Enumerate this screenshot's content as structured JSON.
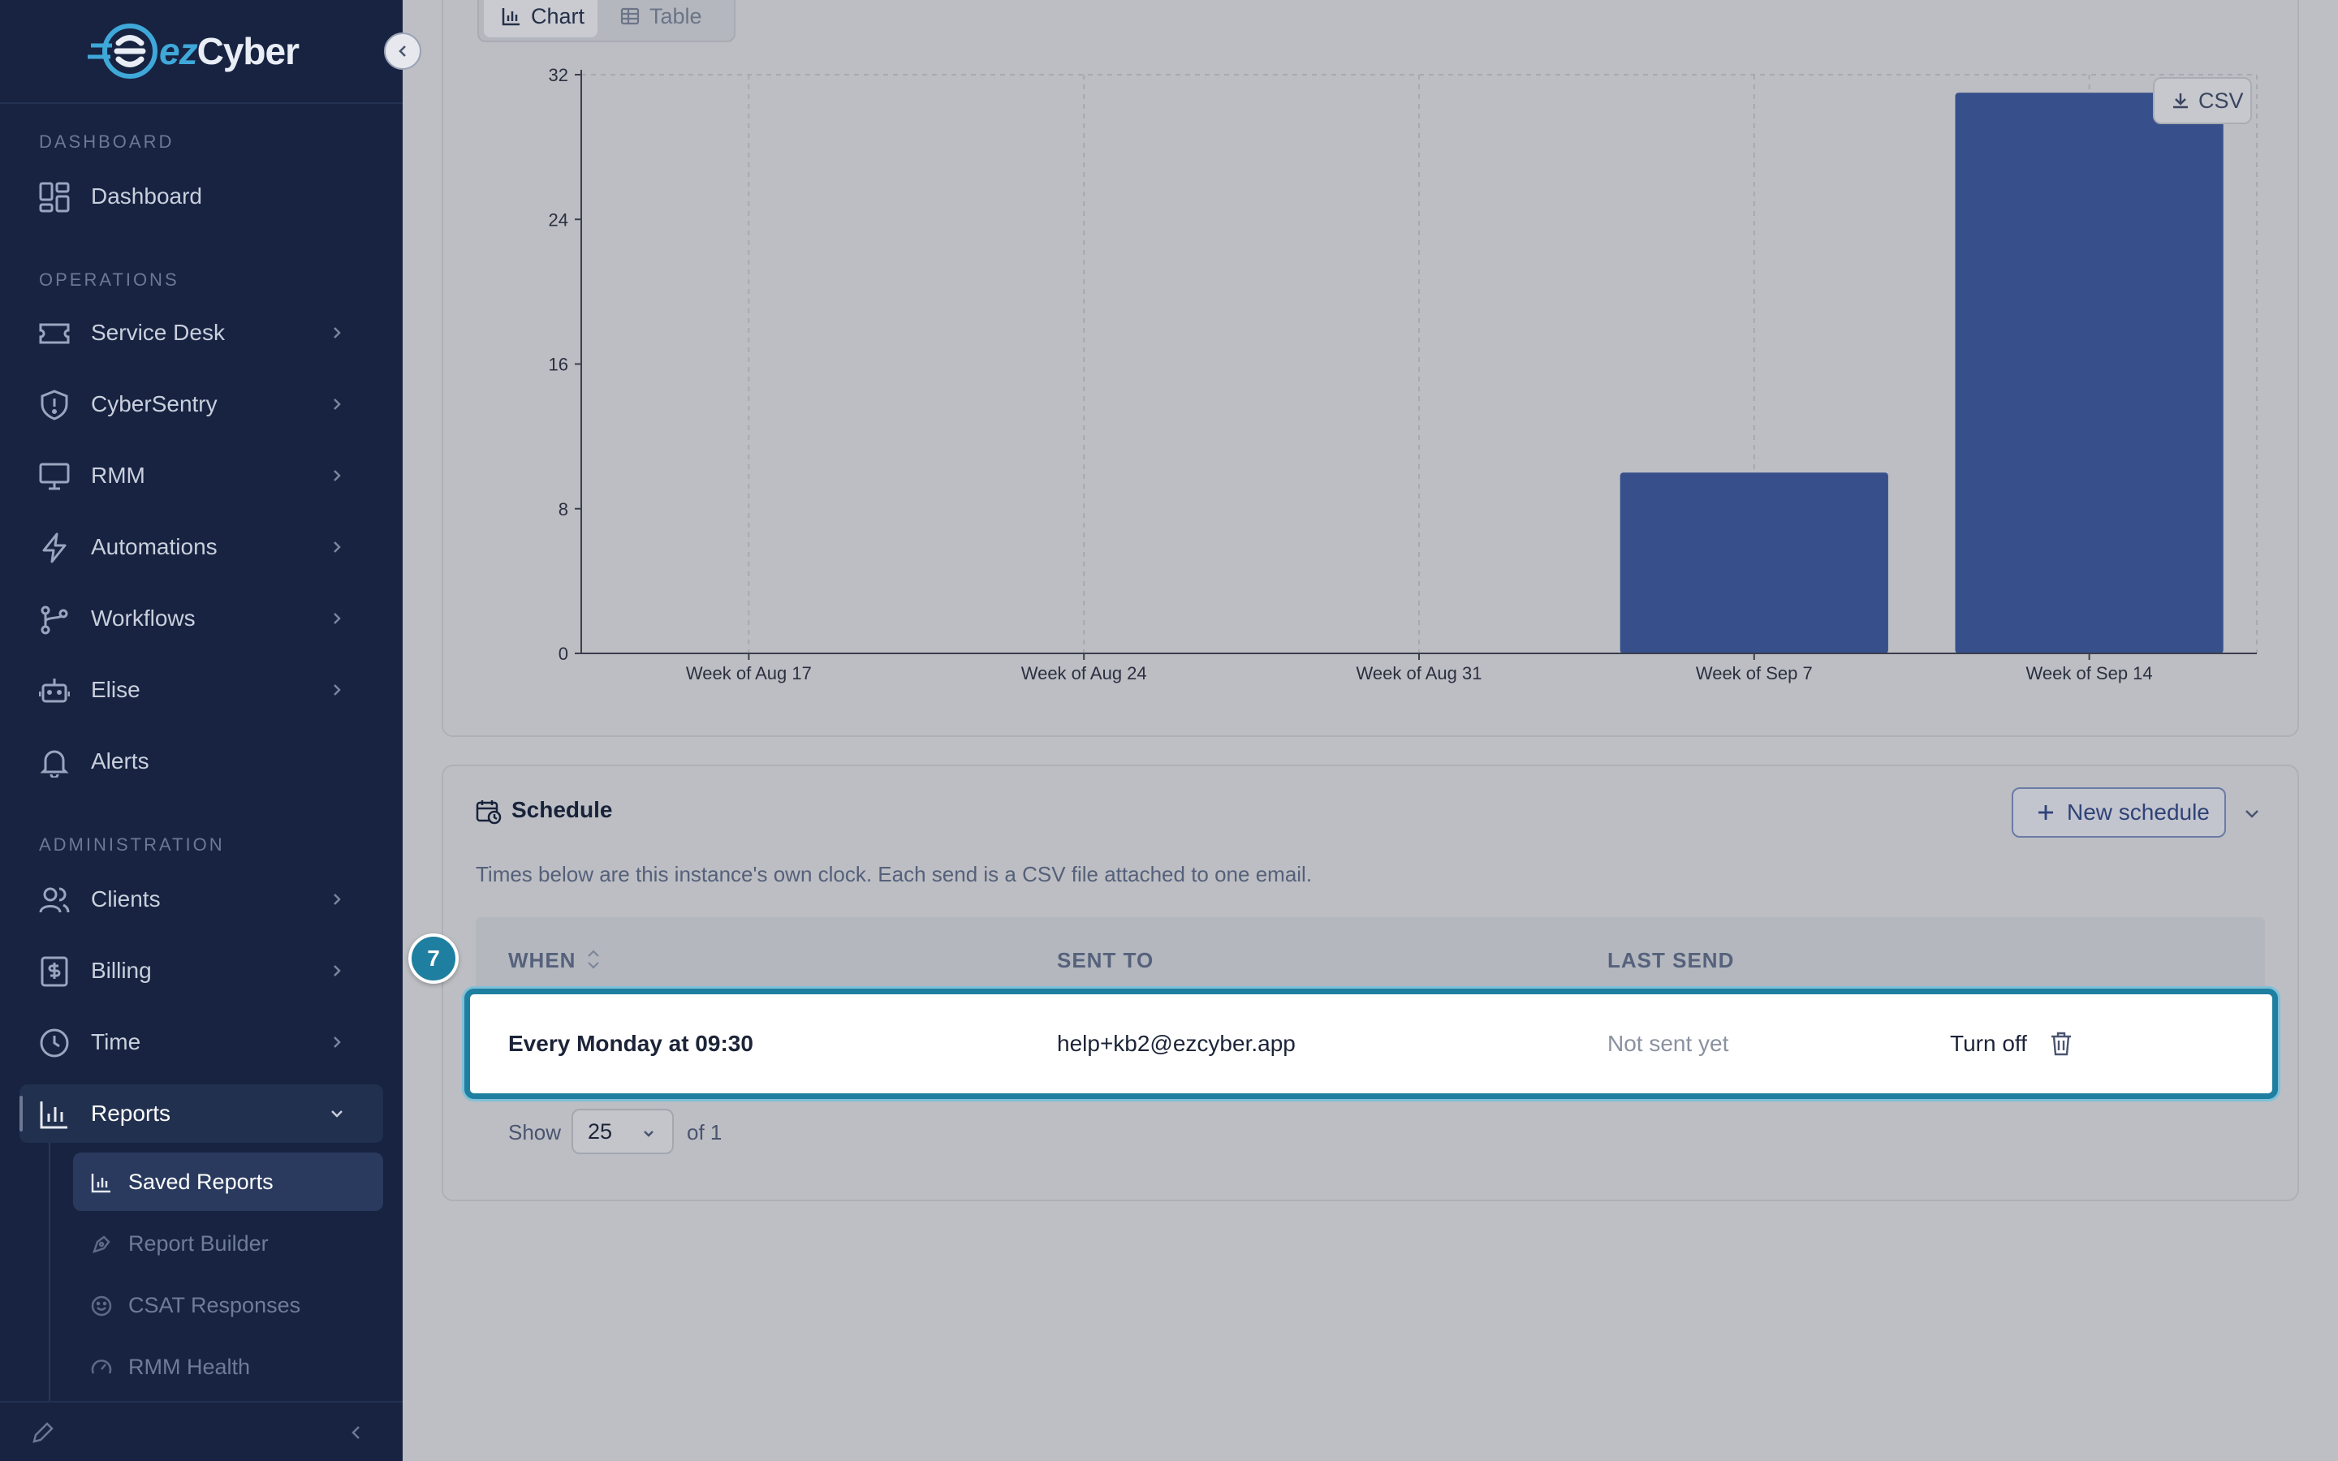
{
  "brand": {
    "ez": "ez",
    "cyber": "Cyber",
    "accent": "#3fa8d9"
  },
  "sidebar": {
    "sections": {
      "dashboard": "DASHBOARD",
      "operations": "OPERATIONS",
      "administration": "ADMINISTRATION"
    },
    "items": {
      "dashboard": "Dashboard",
      "service_desk": "Service Desk",
      "cybersentry": "CyberSentry",
      "rmm": "RMM",
      "automations": "Automations",
      "workflows": "Workflows",
      "elise": "Elise",
      "alerts": "Alerts",
      "clients": "Clients",
      "billing": "Billing",
      "time": "Time",
      "reports": "Reports"
    },
    "sub_items": {
      "saved_reports": "Saved Reports",
      "report_builder": "Report Builder",
      "csat_responses": "CSAT Responses",
      "rmm_health": "RMM Health"
    }
  },
  "view_toggle": {
    "chart": "Chart",
    "table": "Table",
    "selected": "Chart"
  },
  "csv_button": "CSV",
  "chart_data": {
    "type": "bar",
    "categories": [
      "Week of Aug 17",
      "Week of Aug 24",
      "Week of Aug 31",
      "Week of Sep 7",
      "Week of Sep 14"
    ],
    "values": [
      0,
      0,
      0,
      10,
      31
    ],
    "yticks": [
      0,
      8,
      16,
      24,
      32
    ],
    "ylim": [
      0,
      32
    ],
    "bar_color": "#374f8a",
    "grid": "vertical dashed",
    "title": "",
    "xlabel": "",
    "ylabel": ""
  },
  "schedule": {
    "title": "Schedule",
    "new_button": "New schedule",
    "description": "Times below are this instance's own clock. Each send is a CSV file attached to one email.",
    "columns": {
      "when": "WHEN",
      "sent_to": "SENT TO",
      "last_send": "LAST SEND"
    },
    "rows": [
      {
        "when": "Every Monday at 09:30",
        "sent_to": "help+kb2@ezcyber.app",
        "last_send": "Not sent yet",
        "action": "Turn off"
      }
    ],
    "highlight_badge": "7",
    "pager": {
      "show": "Show",
      "page_size": "25",
      "of": "of 1"
    }
  }
}
